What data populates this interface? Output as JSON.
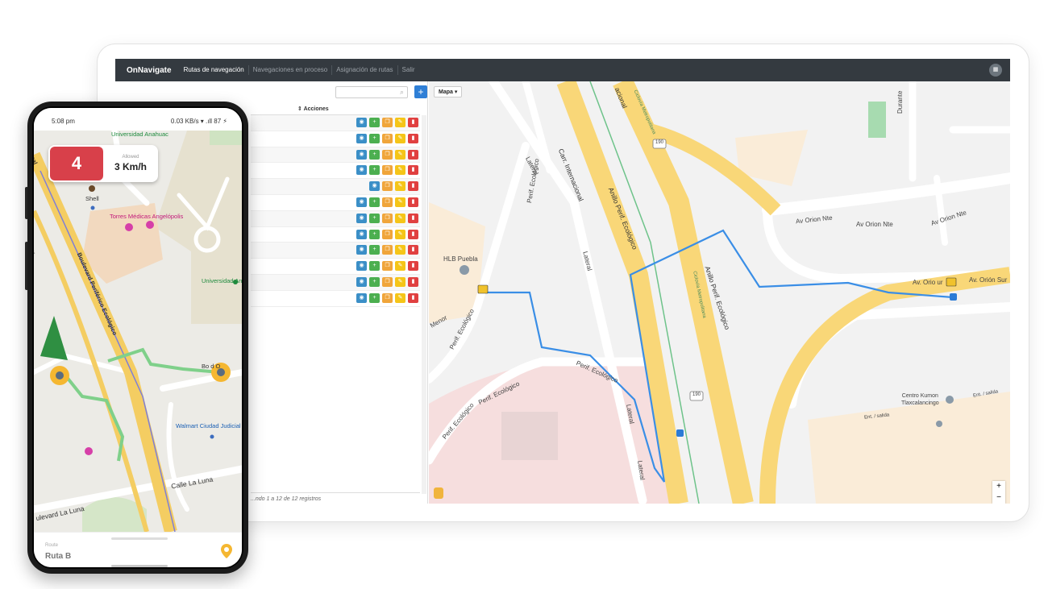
{
  "desktop": {
    "brand": "OnNavigate",
    "nav": [
      {
        "label": "Rutas de navegación",
        "active": true
      },
      {
        "label": "Navegaciones en proceso",
        "active": false
      },
      {
        "label": "Asignación de rutas",
        "active": false
      },
      {
        "label": "Salir",
        "active": false
      }
    ],
    "add_label": "+",
    "table_header": "Acciones",
    "row_count": 12,
    "row_actions": [
      [
        "eye-icon",
        "plus-icon",
        "copy-icon",
        "edit-icon",
        "delete-icon"
      ],
      [
        "eye-icon",
        "plus-icon",
        "copy-icon",
        "edit-icon",
        "delete-icon"
      ],
      [
        "eye-icon",
        "plus-icon",
        "copy-icon",
        "edit-icon",
        "delete-icon"
      ],
      [
        "eye-icon",
        "plus-icon",
        "copy-icon",
        "edit-icon",
        "delete-icon"
      ],
      [
        "eye-icon",
        "copy-icon",
        "edit-icon",
        "delete-icon"
      ],
      [
        "eye-icon",
        "plus-icon",
        "copy-icon",
        "edit-icon",
        "delete-icon"
      ],
      [
        "eye-icon",
        "plus-icon",
        "copy-icon",
        "edit-icon",
        "delete-icon"
      ],
      [
        "eye-icon",
        "plus-icon",
        "copy-icon",
        "edit-icon",
        "delete-icon"
      ],
      [
        "eye-icon",
        "plus-icon",
        "copy-icon",
        "edit-icon",
        "delete-icon"
      ],
      [
        "eye-icon",
        "plus-icon",
        "copy-icon",
        "edit-icon",
        "delete-icon"
      ],
      [
        "eye-icon",
        "plus-icon",
        "copy-icon",
        "edit-icon",
        "delete-icon"
      ],
      [
        "eye-icon",
        "plus-icon",
        "copy-icon",
        "edit-icon",
        "delete-icon"
      ]
    ],
    "footer": "...ndo 1 a 12 de 12 registros",
    "map": {
      "type_button": "Mapa ▾",
      "zoom_in": "+",
      "zoom_out": "−",
      "labels": {
        "carr_internacional": "Carr. Internacional",
        "anillo_1": "Anillo Perif. Ecológico",
        "anillo_2": "Anillo Perif. Ecológico",
        "ciclovia_1": "Ciclovía Metropolitana",
        "ciclovia_2": "Ciclovía Metropolitana",
        "orion_nte_1": "Av Orion Nte",
        "orion_nte_2": "Av Orion Nte",
        "orion_nte_3": "Av Orion Nte",
        "orion_sur": "Av. Orio  ur",
        "orion_sur_2": "Av. Orión Sur",
        "hlb": "HLB Puebla",
        "lateral_1": "Lateral",
        "lateral_2": "Lateral",
        "lateral_3": "Lateral",
        "lateral_4": "Lateral",
        "perif_1": "Perif. Ecológico",
        "perif_2": "Perif. Ecológico",
        "perif_3": "Perif. Ecológico",
        "perif_4": "Perif. Ecológico",
        "perif_5": "Perif. Ecológico",
        "perif_6": "Perif. Ecológico",
        "menor": "Menor",
        "kumon": "Centro Kumon\nTlaxcalancingo",
        "durante": "Durante",
        "ent_salida_1": "Ent. / salida",
        "ent_salida_2": "Ent. / salida",
        "hwy_190": "190",
        "nacional": "acional"
      }
    }
  },
  "phone": {
    "time": "5:08 pm",
    "status_right": "0.03 KB/s ▾ .ıll 87 ⚡",
    "speed_limit": "4",
    "speed_label": "Allowed",
    "speed_value": "3 Km/h",
    "labels": {
      "anahuac": "Universidad Anahuac",
      "shell": "Shell",
      "torres": "Torres Médicas Angelópolis",
      "univ_an": "Universidad An",
      "boulevard": "Boulevard Periférico Ecológico",
      "walmart": "Walmart Ciudad Judicial",
      "calle_luna": "Calle La Luna",
      "boulevard_luna": "ulevard La Luna",
      "bolevard_d": "Bo    d O",
      "uey": "uey",
      "nal": "nal"
    },
    "route_label": "Route",
    "route_value": "Ruta B"
  }
}
